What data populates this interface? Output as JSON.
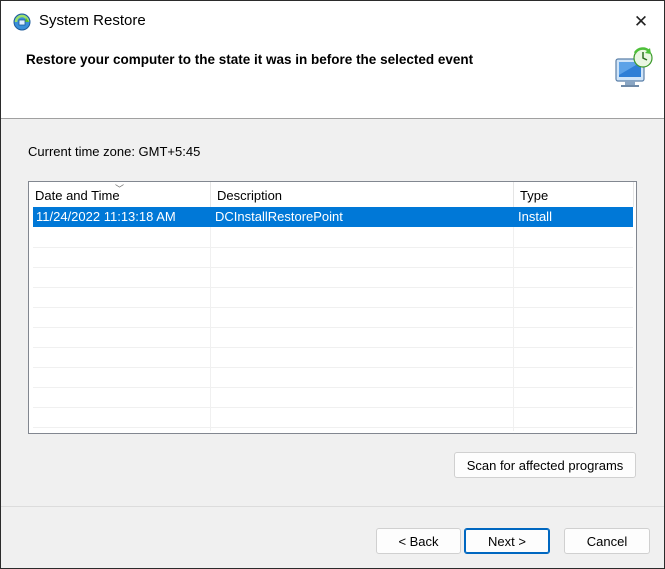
{
  "window": {
    "title": "System Restore",
    "close_glyph": "✕"
  },
  "header": {
    "text": "Restore your computer to the state it was in before the selected event"
  },
  "timezone": {
    "text": "Current time zone: GMT+5:45"
  },
  "restore_list": {
    "columns": [
      "Date and Time",
      "Description",
      "Type"
    ],
    "sort_indicator": "﹀",
    "rows": [
      {
        "date_time": "11/24/2022 11:13:18 AM",
        "description": "DCInstallRestorePoint",
        "type": "Install",
        "selected": true
      }
    ]
  },
  "buttons": {
    "scan": "Scan for affected programs",
    "back": "< Back",
    "next": "Next >",
    "cancel": "Cancel"
  },
  "colors": {
    "selection": "#0078d7",
    "primary_border": "#0067c0"
  },
  "icons": {
    "app": "system-restore-icon",
    "header": "monitor-restore-icon",
    "close": "close-icon"
  }
}
